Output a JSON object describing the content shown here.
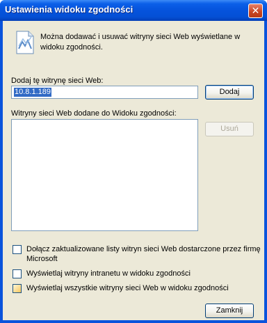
{
  "window": {
    "title": "Ustawienia widoku zgodności",
    "close_glyph": "✕"
  },
  "info": {
    "icon": "compatibility-view-icon",
    "text": "Można dodawać i usuwać witryny sieci Web wyświetlane w widoku zgodności."
  },
  "add_site": {
    "label": "Dodaj tę witrynę sieci Web:",
    "value": "10.8.1.189",
    "button": "Dodaj"
  },
  "site_list": {
    "label": "Witryny sieci Web dodane do Widoku zgodności:",
    "items": [],
    "remove_button": "Usuń"
  },
  "options": [
    {
      "label": "Dołącz zaktualizowane listy witryn sieci Web dostarczone przez firmę Microsoft",
      "checked": false
    },
    {
      "label": "Wyświetlaj witryny intranetu w widoku zgodności",
      "checked": false
    },
    {
      "label": "Wyświetlaj wszystkie witryny sieci Web w widoku zgodności",
      "checked": false
    }
  ],
  "footer": {
    "close_button": "Zamknij"
  },
  "colors": {
    "titlebar": "#0553dc",
    "client": "#ece9d8",
    "selection": "#316ac5"
  }
}
